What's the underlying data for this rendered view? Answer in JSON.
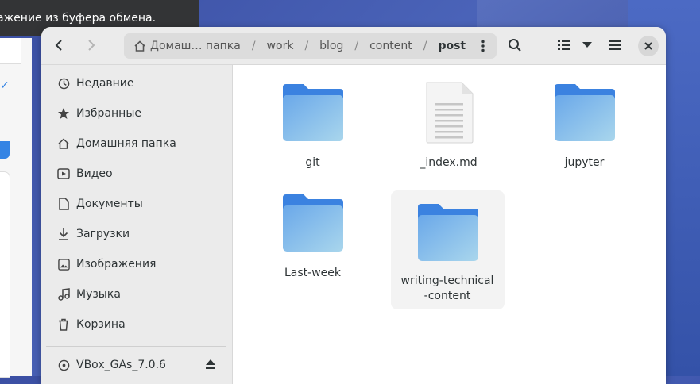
{
  "toast": {
    "message": "ажение из буфера обмена."
  },
  "header": {
    "nav_back": "back-arrow",
    "nav_forward": "forward-arrow",
    "breadcrumb": {
      "home": "Домаш… папка",
      "items": [
        "work",
        "blog",
        "content",
        "post"
      ]
    }
  },
  "sidebar": {
    "places": [
      {
        "label": "Недавние",
        "icon": "clock-icon"
      },
      {
        "label": "Избранные",
        "icon": "star-icon"
      },
      {
        "label": "Домашняя папка",
        "icon": "home-icon"
      },
      {
        "label": "Видео",
        "icon": "video-icon"
      },
      {
        "label": "Документы",
        "icon": "document-icon"
      },
      {
        "label": "Загрузки",
        "icon": "download-icon"
      },
      {
        "label": "Изображения",
        "icon": "image-icon"
      },
      {
        "label": "Музыка",
        "icon": "music-icon"
      },
      {
        "label": "Корзина",
        "icon": "trash-icon"
      }
    ],
    "devices": [
      {
        "label": "VBox_GAs_7.0.6",
        "icon": "disc-icon"
      }
    ]
  },
  "files": [
    {
      "name": "git",
      "type": "folder"
    },
    {
      "name": "_index.md",
      "type": "document"
    },
    {
      "name": "jupyter",
      "type": "folder"
    },
    {
      "name": "Last-week",
      "type": "folder"
    },
    {
      "name": "writing-technical-content",
      "type": "folder",
      "selected": true
    }
  ],
  "colors": {
    "folder_top": "#3b82e0",
    "folder_body": "#8fc1ea",
    "accent": "#3584e4"
  }
}
